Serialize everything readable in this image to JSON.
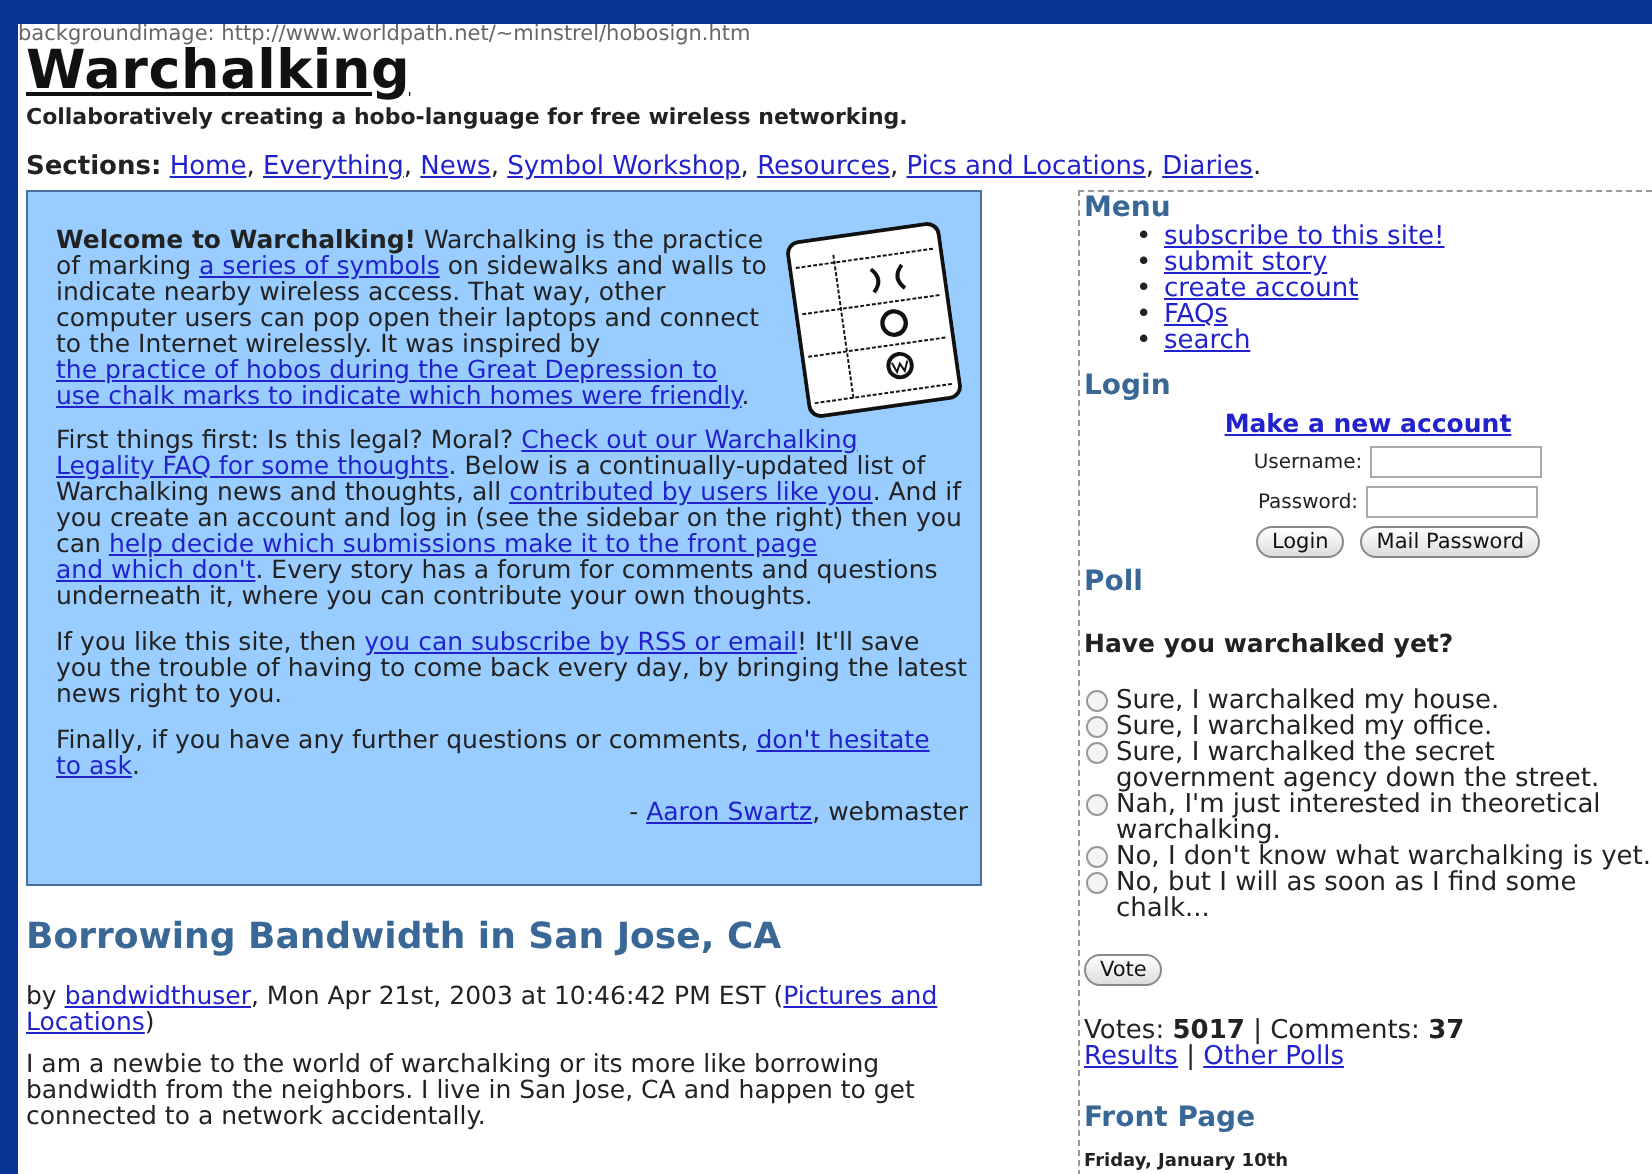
{
  "background_note": "backgroundimage: http://www.worldpath.net/~minstrel/hobosign.htm",
  "site": {
    "title": "Warchalking",
    "tagline": "Collaboratively creating a hobo-language for free wireless networking."
  },
  "sections": {
    "label": "Sections:",
    "separator": ",",
    "links": [
      "Home",
      "Everything",
      "News",
      "Symbol Workshop",
      "Resources",
      "Pics and Locations",
      "Diaries"
    ],
    "end": "."
  },
  "welcome": {
    "paragraphs": [
      [
        {
          "kind": "bold",
          "text": "Welcome to Warchalking!"
        },
        {
          "kind": "text",
          "text": " Warchalking is the practice of marking "
        },
        {
          "kind": "link",
          "text": "a series of symbols"
        },
        {
          "kind": "text",
          "text": " on sidewalks and walls to indicate nearby wireless access. That way, other computer users can pop open their laptops and connect to the Internet wirelessly. It was inspired by "
        },
        {
          "kind": "link",
          "text": "the practice of hobos during the Great Depression to"
        },
        {
          "kind": "link",
          "text": "use chalk marks to indicate which homes were friendly"
        },
        {
          "kind": "text",
          "text": "."
        }
      ],
      [
        {
          "kind": "text",
          "text": "First things first: Is this legal? Moral? "
        },
        {
          "kind": "link",
          "text": "Check out our Warchalking"
        },
        {
          "kind": "link",
          "text": "Legality FAQ for some thoughts"
        },
        {
          "kind": "text",
          "text": ". Below is a continually-updated list of Warchalking news and thoughts, all "
        },
        {
          "kind": "link",
          "text": "contributed by users like you"
        },
        {
          "kind": "text",
          "text": ". And if you create an account and log in (see the sidebar on the right) then you can "
        },
        {
          "kind": "link",
          "text": "help decide which submissions make it to the front page"
        },
        {
          "kind": "link",
          "text": "and which don't"
        },
        {
          "kind": "text",
          "text": ". Every story has a forum for comments and questions underneath it, where you can contribute your own thoughts."
        }
      ],
      [
        {
          "kind": "text",
          "text": "If you like this site, then "
        },
        {
          "kind": "link",
          "text": "you can subscribe by RSS or email"
        },
        {
          "kind": "text",
          "text": "! It'll save you the trouble of having to come back every day, by bringing the latest news right to you."
        }
      ],
      [
        {
          "kind": "text",
          "text": "Finally, if you have any further questions or comments, "
        },
        {
          "kind": "link",
          "text": "don't hesitate"
        },
        {
          "kind": "link",
          "text": "to ask"
        },
        {
          "kind": "text",
          "text": "."
        }
      ]
    ],
    "signature": [
      {
        "kind": "text",
        "text": "- "
      },
      {
        "kind": "link",
        "text": "Aaron Swartz"
      },
      {
        "kind": "text",
        "text": ", webmaster"
      }
    ]
  },
  "story": {
    "title": "Borrowing Bandwidth in San Jose, CA",
    "byline": [
      {
        "kind": "text",
        "text": "by "
      },
      {
        "kind": "link",
        "text": "bandwidthuser"
      },
      {
        "kind": "text",
        "text": ", Mon Apr 21st, 2003 at 10:46:42 PM EST ("
      },
      {
        "kind": "link",
        "text": "Pictures and"
      },
      {
        "kind": "link",
        "text": "Locations"
      },
      {
        "kind": "text",
        "text": ")"
      }
    ],
    "body": "I am a newbie to the world of warchalking or its more like borrowing bandwidth from the neighbors. I live in San Jose, CA and happen to get connected to a network accidentally."
  },
  "sidebar": {
    "menu": {
      "title": "Menu",
      "bullet": "•",
      "items": [
        "subscribe to this site!",
        "submit story",
        "create account",
        "FAQs",
        "search"
      ]
    },
    "login": {
      "title": "Login",
      "new_account": "Make a new account",
      "username_label": "Username:",
      "password_label": "Password:",
      "buttons": [
        "Login",
        "Mail Password"
      ]
    },
    "poll": {
      "title": "Poll",
      "question": "Have you warchalked yet?",
      "options": [
        {
          "label": "Sure, I warchalked my house.",
          "selected": false
        },
        {
          "label": "Sure, I warchalked my office.",
          "selected": false
        },
        {
          "label": "Sure, I warchalked the secret government agency down the street.",
          "selected": false
        },
        {
          "label": "Nah, I'm just interested in theoretical warchalking.",
          "selected": false
        },
        {
          "label": "No, I don't know what warchalking is yet.",
          "selected": false
        },
        {
          "label": "No, but I will as soon as I find some chalk...",
          "selected": false
        }
      ],
      "vote_button": "Vote",
      "votes_label": "Votes:",
      "votes": "5017",
      "separator": "|",
      "comments_label": "Comments:",
      "comments": "37",
      "links": [
        "Results",
        "Other Polls"
      ]
    },
    "front_page": {
      "title": "Front Page",
      "date": "Friday, January 10th"
    }
  }
}
